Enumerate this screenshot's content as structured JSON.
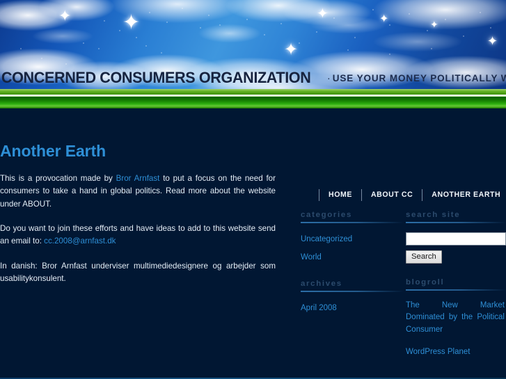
{
  "site": {
    "title": "CONCERNED CONSUMERS ORGANIZATION",
    "separator": "·",
    "tagline": "USE YOUR MONEY POLITICALLY WHEN YOU BUY"
  },
  "nav": {
    "items": [
      {
        "label": "HOME"
      },
      {
        "label": "ABOUT CC"
      },
      {
        "label": "ANOTHER EARTH"
      }
    ]
  },
  "post": {
    "title": "Another Earth",
    "p1_before": "This is a provocation made by ",
    "p1_link": "Bror Arnfast",
    "p1_after": " to put a focus on the need for consumers to take a hand in global politics. Read more about the website under ABOUT.",
    "p2_before": "Do you want to join these efforts and have ideas to add to this website send an email to: ",
    "p2_link": "cc.2008@arnfast.dk",
    "p3": "In danish: Bror Arnfast underviser multimediedesignere og arbejder som usabilitykonsulent."
  },
  "widgets": {
    "categories": {
      "title": "categories",
      "items": [
        {
          "label": "Uncategorized"
        },
        {
          "label": "World"
        }
      ]
    },
    "archives": {
      "title": "archives",
      "items": [
        {
          "label": "April 2008"
        }
      ]
    },
    "search": {
      "title": "search site",
      "value": "",
      "placeholder": "",
      "button_label": "Search"
    },
    "blogroll": {
      "title": "blogroll",
      "items": [
        {
          "label": "The New Market Dominated by the Political Consumer"
        },
        {
          "label": "WordPress Planet"
        }
      ]
    }
  },
  "colors": {
    "page_background": "#011733",
    "accent_link": "#2e8fd6",
    "widget_title": "#2c4b6d",
    "body_text": "#e4ecf5",
    "green_bar": "#1c8c05",
    "header_text": "#16233f"
  }
}
